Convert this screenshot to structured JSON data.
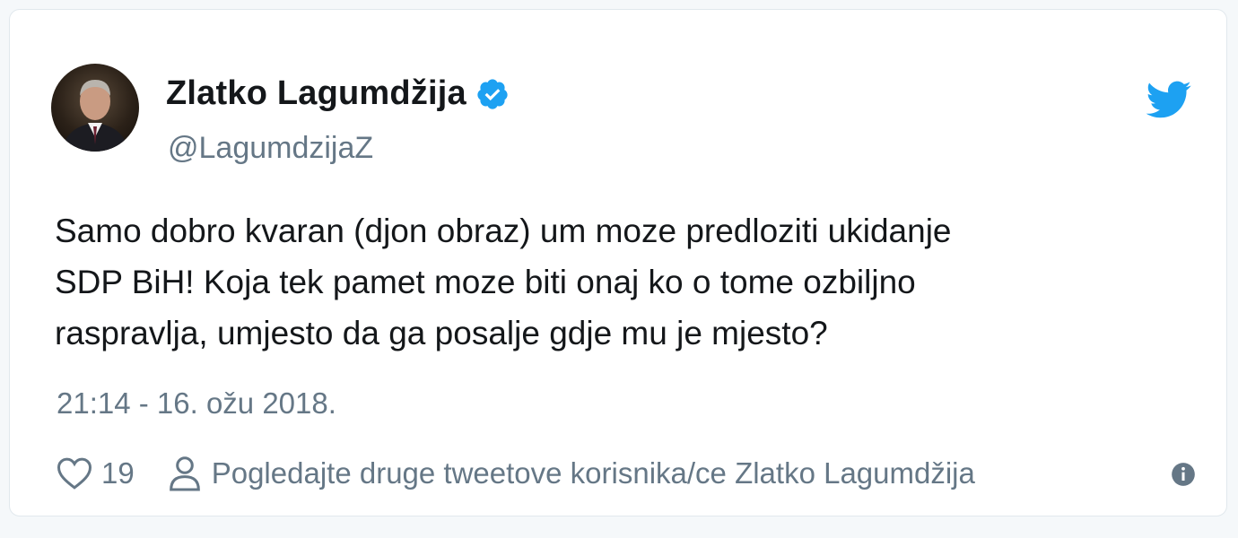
{
  "tweet": {
    "author": {
      "name": "Zlatko Lagumdžija",
      "handle": "@LagumdzijaZ",
      "verified": true
    },
    "text": "Samo dobro kvaran (djon obraz) um moze predloziti ukidanje\nSDP BiH! Koja tek pamet moze biti onaj ko o tome ozbiljno\nraspravlja, umjesto da ga posalje gdje mu je mjesto?",
    "timestamp": "21:14 - 16. ožu 2018.",
    "likes": "19",
    "profile_link_label": "Pogledajte druge tweetove korisnika/ce Zlatko Lagumdžija"
  },
  "icons": {
    "brand": "twitter-bird-icon",
    "verified": "verified-badge-icon",
    "like": "heart-icon",
    "profile": "person-icon",
    "info": "info-icon"
  },
  "colors": {
    "twitter_blue": "#1da1f2",
    "text_primary": "#14171a",
    "text_secondary": "#657786",
    "border": "#e1e8ed"
  }
}
